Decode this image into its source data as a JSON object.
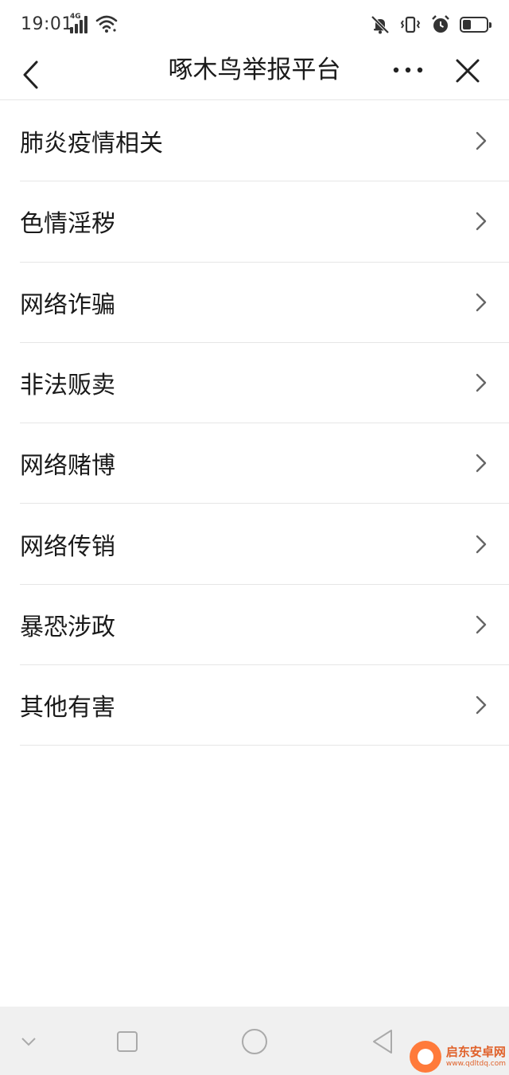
{
  "status_bar": {
    "time": "19:01",
    "network_label": "4G"
  },
  "nav": {
    "title": "啄木鸟举报平台"
  },
  "menu": {
    "items": [
      {
        "label": "肺炎疫情相关"
      },
      {
        "label": "色情淫秽"
      },
      {
        "label": "网络诈骗"
      },
      {
        "label": "非法贩卖"
      },
      {
        "label": "网络赌博"
      },
      {
        "label": "网络传销"
      },
      {
        "label": "暴恐涉政"
      },
      {
        "label": "其他有害"
      }
    ]
  },
  "battery": {
    "level_fraction": 0.35
  },
  "watermark": {
    "name": "启东安卓网",
    "url": "www.qdltdq.com"
  },
  "icons": {
    "back": "chevron-left-icon",
    "more": "more-dots-icon",
    "close": "close-icon",
    "row_arrow": "chevron-right-icon"
  },
  "colors": {
    "divider": "#e6e6e6",
    "text": "#1a1a1a",
    "system_nav_bg": "#f0f0f0",
    "watermark": "#e0612a"
  }
}
